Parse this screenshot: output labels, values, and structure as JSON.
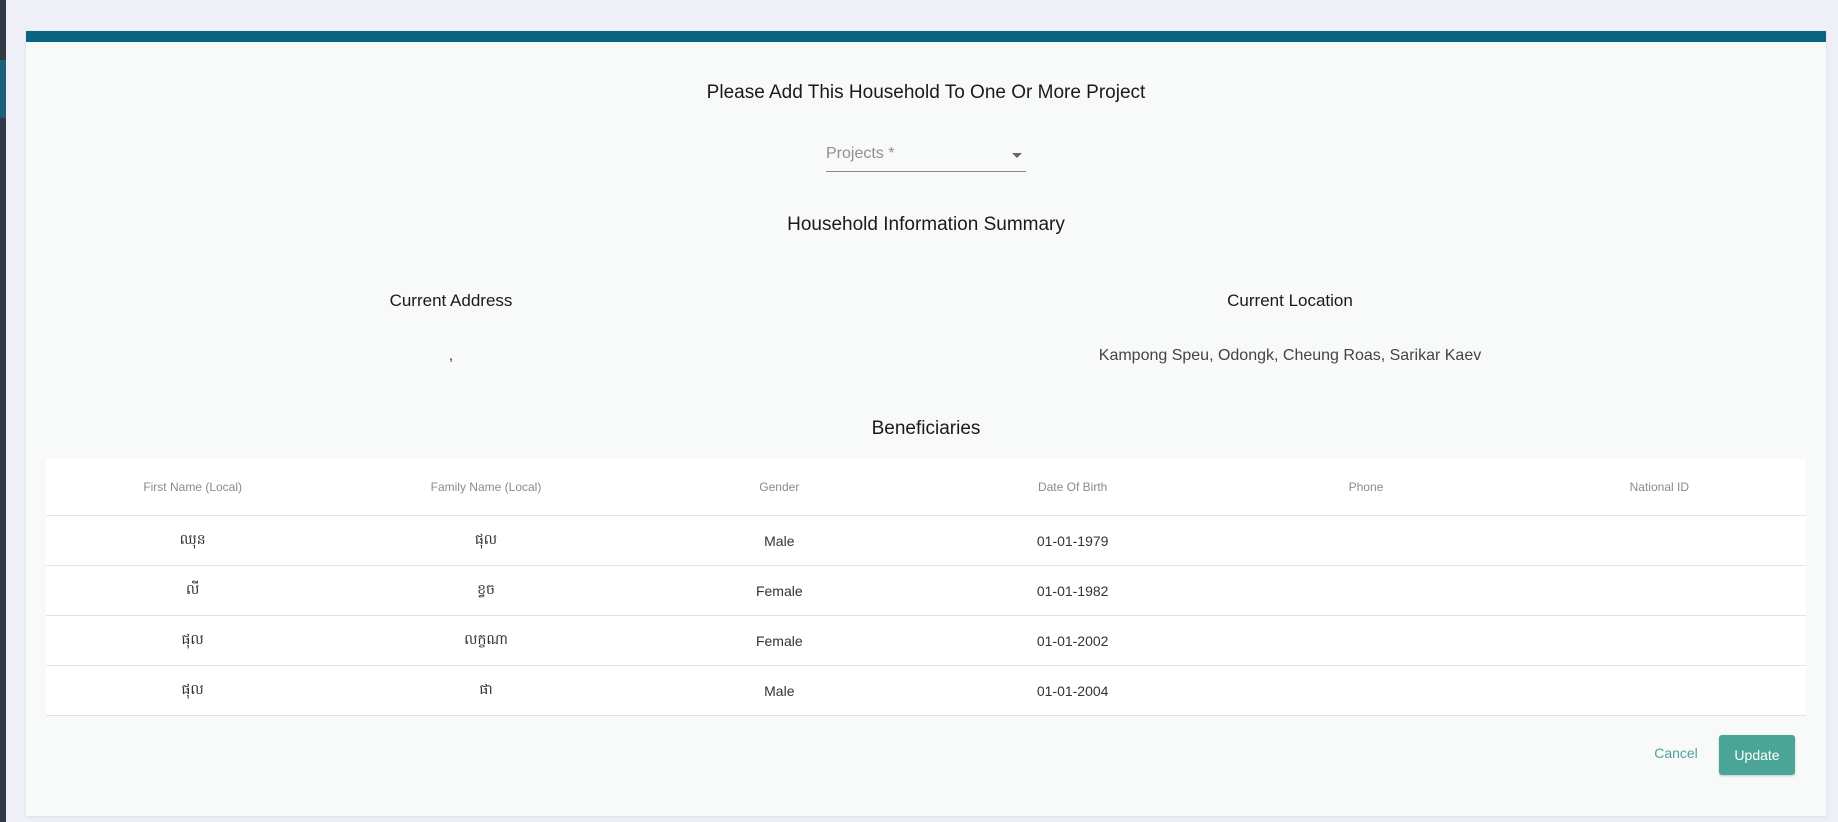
{
  "dialog": {
    "title": "Please Add This Household To One Or More Project",
    "projects_placeholder": "Projects *",
    "summary_title": "Household Information Summary",
    "current_address_label": "Current Address",
    "current_address_value": ",",
    "current_location_label": "Current Location",
    "current_location_value": "Kampong Speu, Odongk, Cheung Roas, Sarikar Kaev",
    "beneficiaries_title": "Beneficiaries",
    "table": {
      "headers": [
        "First Name (Local)",
        "Family Name (Local)",
        "Gender",
        "Date Of Birth",
        "Phone",
        "National ID"
      ],
      "rows": [
        [
          "ឈុន",
          "ផុល",
          "Male",
          "01-01-1979",
          "",
          ""
        ],
        [
          "លី",
          "ខ្វច",
          "Female",
          "01-01-1982",
          "",
          ""
        ],
        [
          "ផុល",
          "លក្ខណា",
          "Female",
          "01-01-2002",
          "",
          ""
        ],
        [
          "ផុល",
          "ផា",
          "Male",
          "01-01-2004",
          "",
          ""
        ]
      ]
    },
    "cancel_label": "Cancel",
    "update_label": "Update"
  },
  "colors": {
    "topbar": "#0b6281",
    "primary_button": "#4aa596",
    "background": "#eff0f7"
  },
  "icons": {
    "select_caret": "caret-down-icon"
  }
}
